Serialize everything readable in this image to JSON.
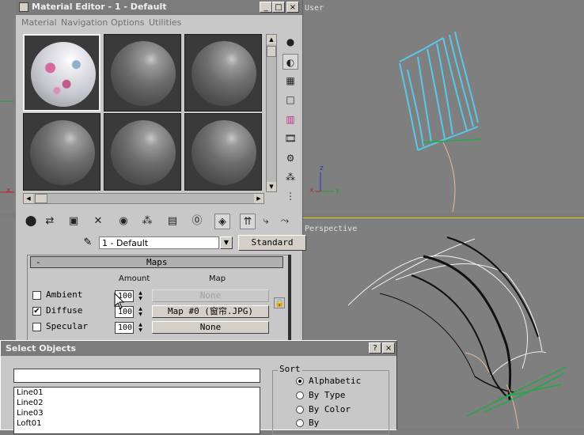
{
  "viewports": {
    "user_label": "User",
    "perspective_label": "Perspective",
    "axis_labels": {
      "x": "x",
      "y": "y",
      "z": "z"
    }
  },
  "material_editor": {
    "title": "Material Editor - 1 - Default",
    "window_buttons": {
      "minimize": "_",
      "maximize": "□",
      "close": "×"
    },
    "menu": [
      "Material",
      "Navigation",
      "Options",
      "Utilities"
    ],
    "material_name": "1 - Default",
    "material_type": "Standard",
    "maps": {
      "header_toggle": "-",
      "header": "Maps",
      "col_amount": "Amount",
      "col_map": "Map",
      "rows": [
        {
          "label": "Ambient",
          "checked": false,
          "amount": "100",
          "map": "None",
          "dim": true
        },
        {
          "label": "Diffuse",
          "checked": true,
          "amount": "100",
          "map": "Map #0 (窗帘.JPG)",
          "dim": false
        },
        {
          "label": "Specular",
          "checked": false,
          "amount": "100",
          "map": "None",
          "dim": false
        }
      ]
    }
  },
  "select_objects": {
    "title": "Select Objects",
    "help_button": "?",
    "close_button": "×",
    "filter_value": "",
    "objects": [
      "Line01",
      "Line02",
      "Line03",
      "Loft01"
    ],
    "sort_title": "Sort",
    "sort_options": [
      {
        "label": "Alphabetic",
        "selected": true
      },
      {
        "label": "By Type",
        "selected": false
      },
      {
        "label": "By Color",
        "selected": false
      },
      {
        "label": "By",
        "selected": false
      }
    ]
  }
}
